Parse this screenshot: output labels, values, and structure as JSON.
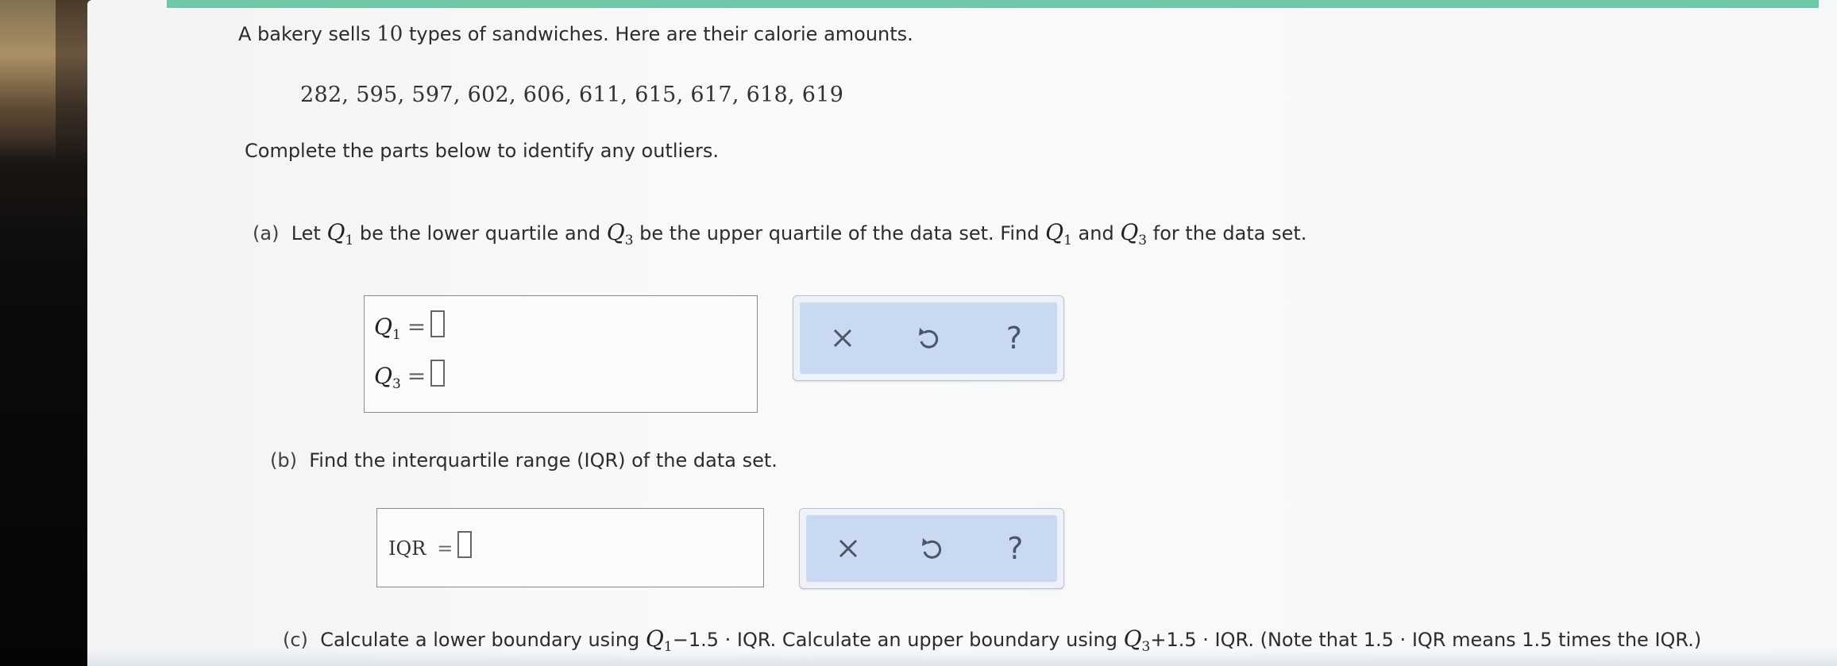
{
  "intro": {
    "text_before": "A bakery sells ",
    "count": "10",
    "text_after": " types of sandwiches. Here are their calorie amounts."
  },
  "dataset": "282, 595, 597, 602, 606, 611, 615, 617, 618, 619",
  "instruction": "Complete the parts below to identify any outliers.",
  "part_a": {
    "label": "(a)",
    "t1": "Let ",
    "t2": " be the lower quartile and ",
    "t3": " be the upper quartile of the data set. Find ",
    "t4": " and ",
    "t5": " for the data set.",
    "q1_letter": "Q",
    "q1_sub": "1",
    "q3_letter": "Q",
    "q3_sub": "3",
    "eq": "=",
    "q1_value": "",
    "q3_value": ""
  },
  "part_b": {
    "label": "(b)",
    "text": "Find the interquartile range (IQR) of the data set.",
    "iqr_label": "IQR",
    "eq": "=",
    "iqr_value": ""
  },
  "part_c": {
    "label": "(c)",
    "t1": "Calculate a lower boundary using ",
    "t2": "−1.5 · IQR. Calculate an upper boundary using ",
    "t3": "+1.5 · IQR. (Note that 1.5 · IQR means 1.5 times the IQR.)",
    "q1_letter": "Q",
    "q1_sub": "1",
    "q3_letter": "Q",
    "q3_sub": "3"
  },
  "toolbar": {
    "clear_icon": "close-icon",
    "undo_icon": "undo-icon",
    "help_glyph": "?"
  },
  "colors": {
    "top_bar": "#6fc7a6",
    "panel_fill": "#c9d9f2",
    "panel_border": "#b9c2d2"
  }
}
